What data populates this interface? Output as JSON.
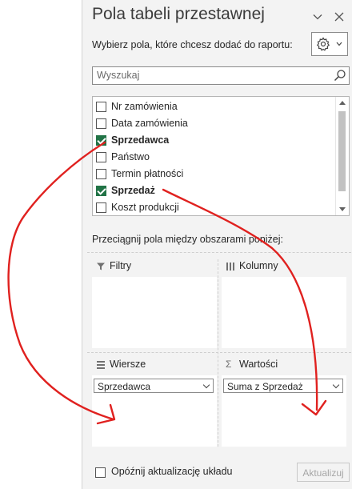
{
  "panel": {
    "title": "Pola tabeli przestawnej",
    "subtitle": "Wybierz pola, które chcesz dodać do raportu:",
    "icons": {
      "dropdown": "chevron-down-icon",
      "close": "close-icon",
      "tools": "gear-icon",
      "search": "search-icon"
    }
  },
  "search": {
    "placeholder": "Wyszukaj"
  },
  "fields": [
    {
      "label": "Nr zamówienia",
      "checked": false
    },
    {
      "label": "Data zamówienia",
      "checked": false
    },
    {
      "label": "Sprzedawca",
      "checked": true
    },
    {
      "label": "Państwo",
      "checked": false
    },
    {
      "label": "Termin płatności",
      "checked": false
    },
    {
      "label": "Sprzedaż",
      "checked": true
    },
    {
      "label": "Koszt produkcji",
      "checked": false
    }
  ],
  "areas": {
    "hint": "Przeciągnij pola między obszarami poniżej:",
    "filters": {
      "label": "Filtry"
    },
    "columns": {
      "label": "Kolumny"
    },
    "rows": {
      "label": "Wiersze",
      "item": "Sprzedawca"
    },
    "values": {
      "label": "Wartości",
      "item": "Suma z Sprzedaż"
    }
  },
  "footer": {
    "defer_label": "Opóźnij aktualizację układu",
    "update_label": "Aktualizuj"
  },
  "colors": {
    "check": "#217346",
    "annotation": "#e0211f"
  }
}
